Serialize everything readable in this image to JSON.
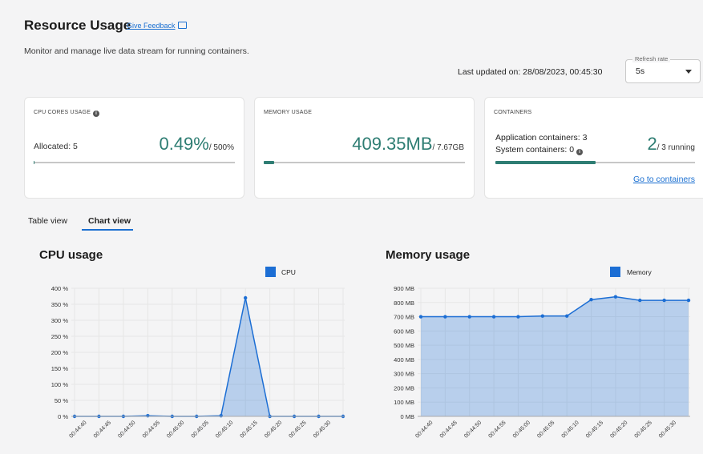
{
  "header": {
    "title": "Resource Usage",
    "feedback_label": "Give Feedback",
    "subtitle": "Monitor and manage live data stream for running containers.",
    "last_updated": "Last updated on: 28/08/2023, 00:45:30",
    "refresh_label": "Refresh rate",
    "refresh_value": "5s"
  },
  "cards": {
    "cpu": {
      "title": "CPU CORES USAGE",
      "allocated": "Allocated: 5",
      "value": "0.49%",
      "total": "/ 500%",
      "fill_percent": 0.1
    },
    "memory": {
      "title": "MEMORY USAGE",
      "value": "409.35MB",
      "total": "/ 7.67GB",
      "fill_percent": 5.2
    },
    "containers": {
      "title": "CONTAINERS",
      "app_line": "Application containers: 3",
      "sys_line": "System containers: 0",
      "value": "2",
      "total": "/ 3 running",
      "fill_percent": 50,
      "link": "Go to containers"
    }
  },
  "tabs": [
    {
      "label": "Table view",
      "active": false
    },
    {
      "label": "Chart view",
      "active": true
    }
  ],
  "colors": {
    "accent": "#2e7d73",
    "link": "#1a6fd1",
    "series": "#1c6ed4"
  },
  "chart_data": [
    {
      "type": "area",
      "title": "CPU usage",
      "series": [
        {
          "name": "CPU",
          "values": [
            0,
            0,
            0,
            2,
            0,
            0,
            2,
            370,
            0,
            0,
            0,
            0
          ]
        }
      ],
      "x": [
        "00:44:40",
        "00:44:45",
        "00:44:50",
        "00:44:55",
        "00:45:00",
        "00:45:05",
        "00:45:10",
        "00:45:15",
        "00:45:20",
        "00:45:25",
        "00:45:30"
      ],
      "yticks": [
        "0 %",
        "50 %",
        "100 %",
        "150 %",
        "200 %",
        "250 %",
        "300 %",
        "350 %",
        "400 %"
      ],
      "ylim": [
        0,
        400
      ],
      "legend": "top-right",
      "grid": true
    },
    {
      "type": "area",
      "title": "Memory usage",
      "series": [
        {
          "name": "Memory",
          "values": [
            700,
            700,
            700,
            700,
            700,
            705,
            705,
            820,
            840,
            815,
            815,
            815
          ]
        }
      ],
      "x": [
        "00:44:40",
        "00:44:45",
        "00:44:50",
        "00:44:55",
        "00:45:00",
        "00:45:05",
        "00:45:10",
        "00:45:15",
        "00:45:20",
        "00:45:25",
        "00:45:30"
      ],
      "yticks": [
        "0 MB",
        "100 MB",
        "200 MB",
        "300 MB",
        "400 MB",
        "500 MB",
        "600 MB",
        "700 MB",
        "800 MB",
        "900 MB"
      ],
      "ylim": [
        0,
        900
      ],
      "legend": "top-right",
      "grid": true
    }
  ]
}
